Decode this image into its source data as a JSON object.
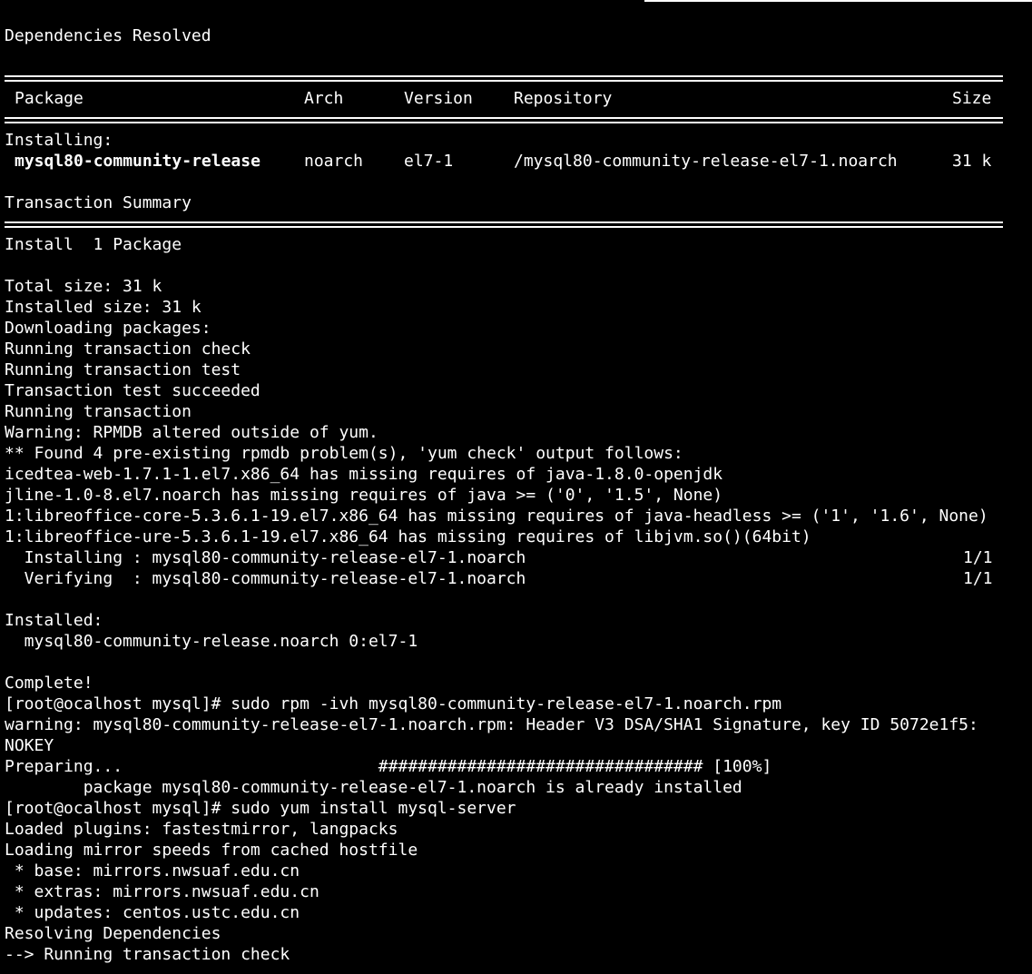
{
  "terminal": {
    "header": "Dependencies Resolved",
    "table_columns": {
      "package": "Package",
      "arch": "Arch",
      "version": "Version",
      "repository": "Repository",
      "size": "Size"
    },
    "installing_label": "Installing:",
    "installing_row": {
      "package": "mysql80-community-release",
      "arch": "noarch",
      "version": "el7-1",
      "repository": "/mysql80-community-release-el7-1.noarch",
      "size": "31 k"
    },
    "transaction_summary": "Transaction Summary",
    "install_count": "Install  1 Package",
    "lines_a": [
      "Total size: 31 k",
      "Installed size: 31 k",
      "Downloading packages:",
      "Running transaction check",
      "Running transaction test",
      "Transaction test succeeded",
      "Running transaction",
      "Warning: RPMDB altered outside of yum.",
      "** Found 4 pre-existing rpmdb problem(s), 'yum check' output follows:",
      "icedtea-web-1.7.1-1.el7.x86_64 has missing requires of java-1.8.0-openjdk",
      "jline-1.0-8.el7.noarch has missing requires of java >= ('0', '1.5', None)",
      "1:libreoffice-core-5.3.6.1-19.el7.x86_64 has missing requires of java-headless >= ('1', '1.6', None)",
      "1:libreoffice-ure-5.3.6.1-19.el7.x86_64 has missing requires of libjvm.so()(64bit)"
    ],
    "progress": [
      {
        "label": "  Installing : mysql80-community-release-el7-1.noarch",
        "count": "1/1"
      },
      {
        "label": "  Verifying  : mysql80-community-release-el7-1.noarch",
        "count": "1/1"
      }
    ],
    "installed_label": "Installed:",
    "installed_pkg": "  mysql80-community-release.noarch 0:el7-1",
    "lines_b": [
      "Complete!",
      "[root@ocalhost mysql]# sudo rpm -ivh mysql80-community-release-el7-1.noarch.rpm",
      "warning: mysql80-community-release-el7-1.noarch.rpm: Header V3 DSA/SHA1 Signature, key ID 5072e1f5:",
      "NOKEY",
      "Preparing...                          ################################# [100%]",
      "        package mysql80-community-release-el7-1.noarch is already installed",
      "[root@ocalhost mysql]# sudo yum install mysql-server",
      "Loaded plugins: fastestmirror, langpacks",
      "Loading mirror speeds from cached hostfile",
      " * base: mirrors.nwsuaf.edu.cn",
      " * extras: mirrors.nwsuaf.edu.cn",
      " * updates: centos.ustc.edu.cn",
      "Resolving Dependencies",
      "--> Running transaction check"
    ]
  }
}
